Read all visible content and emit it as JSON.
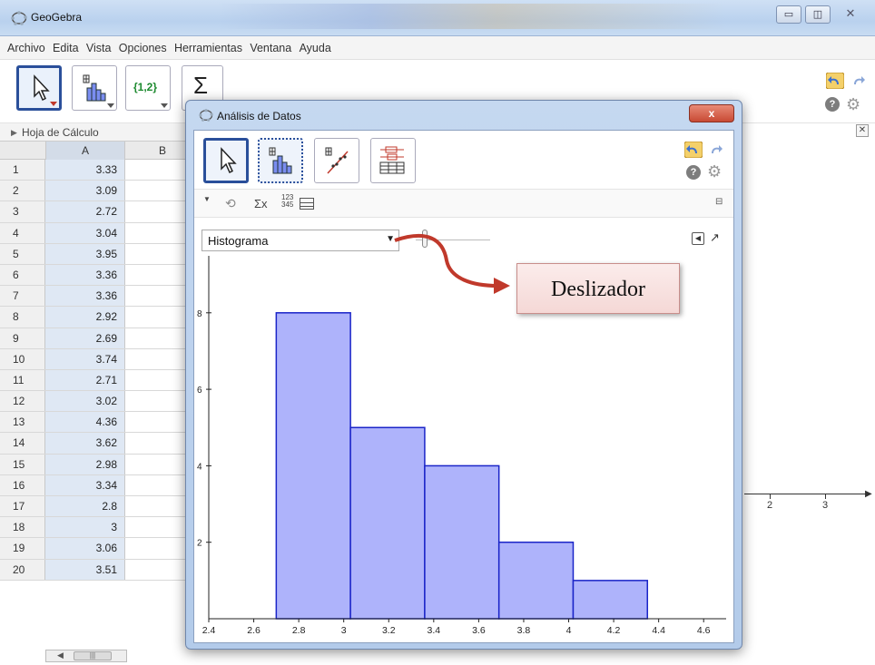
{
  "window": {
    "title": "GeoGebra"
  },
  "menu": [
    "Archivo",
    "Edita",
    "Vista",
    "Opciones",
    "Herramientas",
    "Ventana",
    "Ayuda"
  ],
  "toolbar": {
    "tools": [
      "move",
      "one-variable-analysis",
      "list",
      "sum"
    ],
    "list_label": "{1,2}",
    "sum_label": "Σ"
  },
  "spreadsheet": {
    "panel_title": "Hoja de Cálculo",
    "columns": [
      "A",
      "B"
    ],
    "rows": [
      {
        "n": "1",
        "a": "3.33"
      },
      {
        "n": "2",
        "a": "3.09"
      },
      {
        "n": "3",
        "a": "2.72"
      },
      {
        "n": "4",
        "a": "3.04"
      },
      {
        "n": "5",
        "a": "3.95"
      },
      {
        "n": "6",
        "a": "3.36"
      },
      {
        "n": "7",
        "a": "3.36"
      },
      {
        "n": "8",
        "a": "2.92"
      },
      {
        "n": "9",
        "a": "2.69"
      },
      {
        "n": "10",
        "a": "3.74"
      },
      {
        "n": "11",
        "a": "2.71"
      },
      {
        "n": "12",
        "a": "3.02"
      },
      {
        "n": "13",
        "a": "4.36"
      },
      {
        "n": "14",
        "a": "3.62"
      },
      {
        "n": "15",
        "a": "2.98"
      },
      {
        "n": "16",
        "a": "3.34"
      },
      {
        "n": "17",
        "a": "2.8"
      },
      {
        "n": "18",
        "a": "3"
      },
      {
        "n": "19",
        "a": "3.06"
      },
      {
        "n": "20",
        "a": "3.51"
      }
    ]
  },
  "graphics": {
    "axis_labels": [
      "2",
      "3"
    ]
  },
  "dialog": {
    "title": "Análisis de Datos",
    "close_label": "x",
    "options": {
      "sigma_label": "Σx",
      "stats_label_top": "123",
      "stats_label_bottom": "345"
    },
    "plot_select": {
      "selected": "Histograma"
    }
  },
  "callout": {
    "text": "Deslizador"
  },
  "colors": {
    "bar_fill": "#aeb3fb",
    "bar_stroke": "#1a24c8",
    "callout_arrow": "#c0392b",
    "selected_tool_border": "#2a4f9a"
  },
  "chart_data": {
    "type": "bar",
    "title": "",
    "xlabel": "",
    "ylabel": "",
    "bins": [
      {
        "from": 2.7,
        "to": 3.03,
        "count": 8
      },
      {
        "from": 3.03,
        "to": 3.36,
        "count": 5
      },
      {
        "from": 3.36,
        "to": 3.69,
        "count": 4
      },
      {
        "from": 3.69,
        "to": 4.02,
        "count": 2
      },
      {
        "from": 4.02,
        "to": 4.35,
        "count": 1
      }
    ],
    "xlim": [
      2.4,
      4.7
    ],
    "ylim": [
      0,
      9.3
    ],
    "x_ticks": [
      "2.4",
      "2.6",
      "2.8",
      "3",
      "3.2",
      "3.4",
      "3.6",
      "3.8",
      "4",
      "4.2",
      "4.4",
      "4.6"
    ],
    "y_ticks": [
      "2",
      "4",
      "6",
      "8"
    ]
  }
}
